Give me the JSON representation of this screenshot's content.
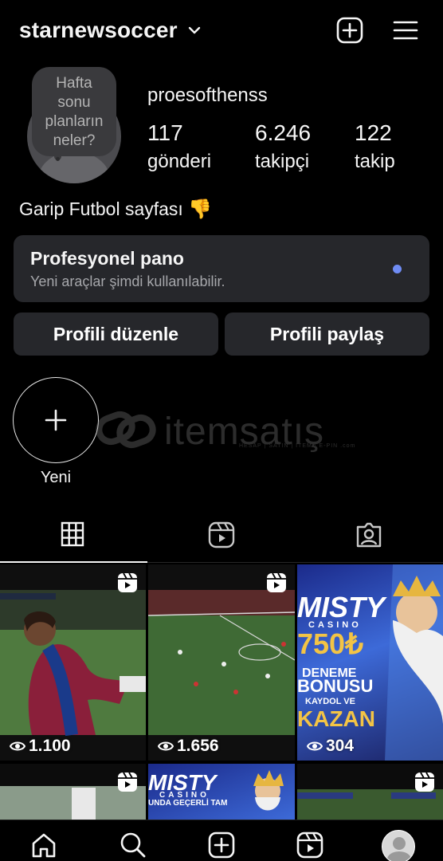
{
  "header": {
    "username": "starnewsoccer",
    "icons": [
      "chevron-down-icon",
      "plus-square-icon",
      "menu-icon"
    ]
  },
  "profile": {
    "note": [
      "Hafta",
      "sonu",
      "planların",
      "neler?"
    ],
    "display_name": "proesofthenss",
    "stats": [
      {
        "value": "117",
        "label": "gönderi"
      },
      {
        "value": "6.246",
        "label": "takipçi"
      },
      {
        "value": "122",
        "label": "takip"
      }
    ],
    "bio": "Garip Futbol sayfası",
    "bio_emoji": "👎"
  },
  "pro_dashboard": {
    "title": "Profesyonel pano",
    "subtitle": "Yeni araçlar şimdi kullanılabilir."
  },
  "buttons": {
    "edit": "Profili düzenle",
    "share": "Profili paylaş"
  },
  "highlights": {
    "new_label": "Yeni"
  },
  "watermark": {
    "text": "itemsatış",
    "sub": "HESAP | SATIN | ITEM | E-PIN .com"
  },
  "tabs": [
    "grid-icon",
    "reels-icon",
    "tagged-icon"
  ],
  "posts": [
    {
      "views": "1.100",
      "reel": true
    },
    {
      "views": "1.656",
      "reel": true
    },
    {
      "views": "304",
      "reel": false,
      "ad_lines": [
        "MISTY",
        "CASINO",
        "750₺",
        "DENEME",
        "BONUSU",
        "KAYDOL VE",
        "KAZAN"
      ]
    },
    {
      "views": "",
      "reel": true
    },
    {
      "views": "",
      "reel": false,
      "ad_lines": [
        "MISTY",
        "CASINO",
        "UNDA GEÇERLİ TAM"
      ]
    },
    {
      "views": "",
      "reel": true
    }
  ],
  "bottom_nav": [
    "home-icon",
    "search-icon",
    "create-icon",
    "reels-icon",
    "profile-avatar"
  ],
  "colors": {
    "background": "#000000",
    "card": "#26272b",
    "accent_dot": "#6f8cf4",
    "muted_text": "#a6a7ab"
  }
}
